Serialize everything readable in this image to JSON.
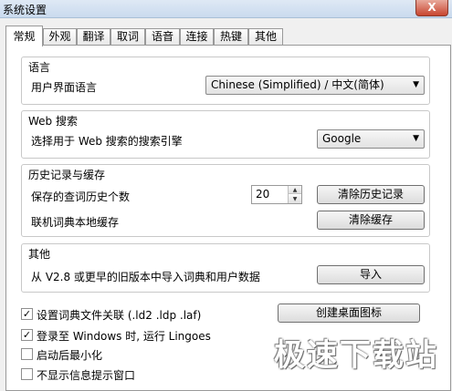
{
  "window": {
    "title": "系统设置",
    "close_label": "X"
  },
  "tabs": [
    "常规",
    "外观",
    "翻译",
    "取词",
    "语音",
    "连接",
    "热键",
    "其他"
  ],
  "language_group": {
    "title": "语言",
    "label": "用户界面语言",
    "selected": "Chinese (Simplified) / 中文(简体)"
  },
  "web_group": {
    "title": "Web 搜索",
    "label": "选择用于 Web 搜索的搜索引擎",
    "selected": "Google"
  },
  "history_group": {
    "title": "历史记录与缓存",
    "count_label": "保存的查词历史个数",
    "count_value": "20",
    "clear_history_button": "清除历史记录",
    "cache_label": "联机词典本地缓存",
    "clear_cache_button": "清除缓存"
  },
  "other_group": {
    "title": "其他",
    "import_label": "从 V2.8 或更早的旧版本中导入词典和用户数据",
    "import_button": "导入"
  },
  "options": [
    {
      "label": "设置词典文件关联 (.ld2 .ldp .laf)",
      "checked": true
    },
    {
      "label": "登录至 Windows 时, 运行 Lingoes",
      "checked": true
    },
    {
      "label": "启动后最小化",
      "checked": false
    },
    {
      "label": "不显示信息提示窗口",
      "checked": false
    }
  ],
  "desktop_icon_button": "创建桌面图标",
  "watermark": "极速下载站"
}
